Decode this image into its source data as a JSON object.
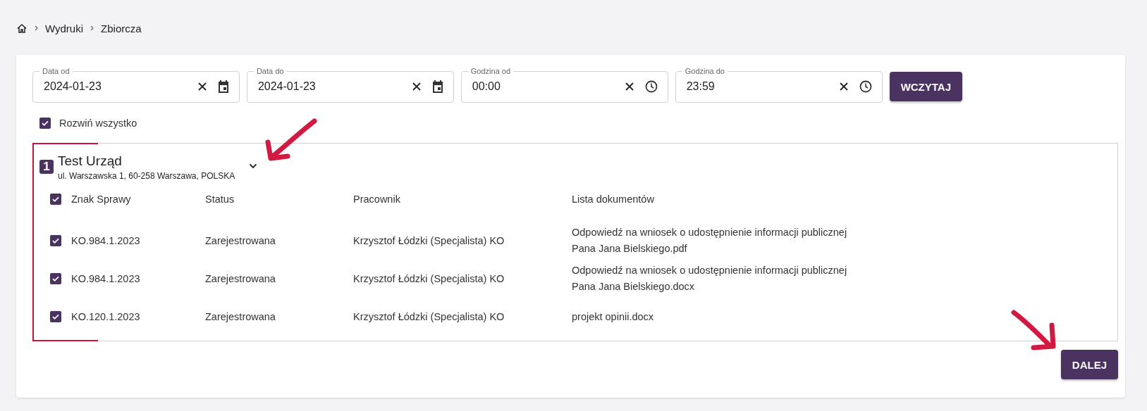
{
  "breadcrumb": [
    {
      "label": "Wydruki"
    },
    {
      "label": "Zbiorcza"
    }
  ],
  "filters": [
    {
      "label": "Data od",
      "value": "2024-01-23",
      "kind": "date"
    },
    {
      "label": "Data do",
      "value": "2024-01-23",
      "kind": "date"
    },
    {
      "label": "Godzina od",
      "value": "00:00",
      "kind": "time"
    },
    {
      "label": "Godzina do",
      "value": "23:59",
      "kind": "time"
    }
  ],
  "load_button": "WCZYTAJ",
  "expand_all": {
    "label": "Rozwiń wszystko",
    "checked": true
  },
  "group": {
    "number": "1",
    "name": "Test Urząd",
    "address": "ul. Warszawska 1, 60-258 Warszawa, POLSKA",
    "expanded": true,
    "select_all_checked": true,
    "columns": [
      "Znak Sprawy",
      "Status",
      "Pracownik",
      "Lista dokumentów"
    ],
    "rows": [
      {
        "checked": true,
        "case": "KO.984.1.2023",
        "status": "Zarejestrowana",
        "employee": "Krzysztof Łódzki (Specjalista) KO",
        "document": "Odpowiedź na wniosek o udostępnienie informacji publicznej Pana Jana Bielskiego.pdf"
      },
      {
        "checked": true,
        "case": "KO.984.1.2023",
        "status": "Zarejestrowana",
        "employee": "Krzysztof Łódzki (Specjalista) KO",
        "document": "Odpowiedź na wniosek o udostępnienie informacji publicznej Pana Jana Bielskiego.docx"
      },
      {
        "checked": true,
        "case": "KO.120.1.2023",
        "status": "Zarejestrowana",
        "employee": "Krzysztof Łódzki (Specjalista) KO",
        "document": "projekt opinii.docx"
      }
    ]
  },
  "next_button": "DALEJ"
}
